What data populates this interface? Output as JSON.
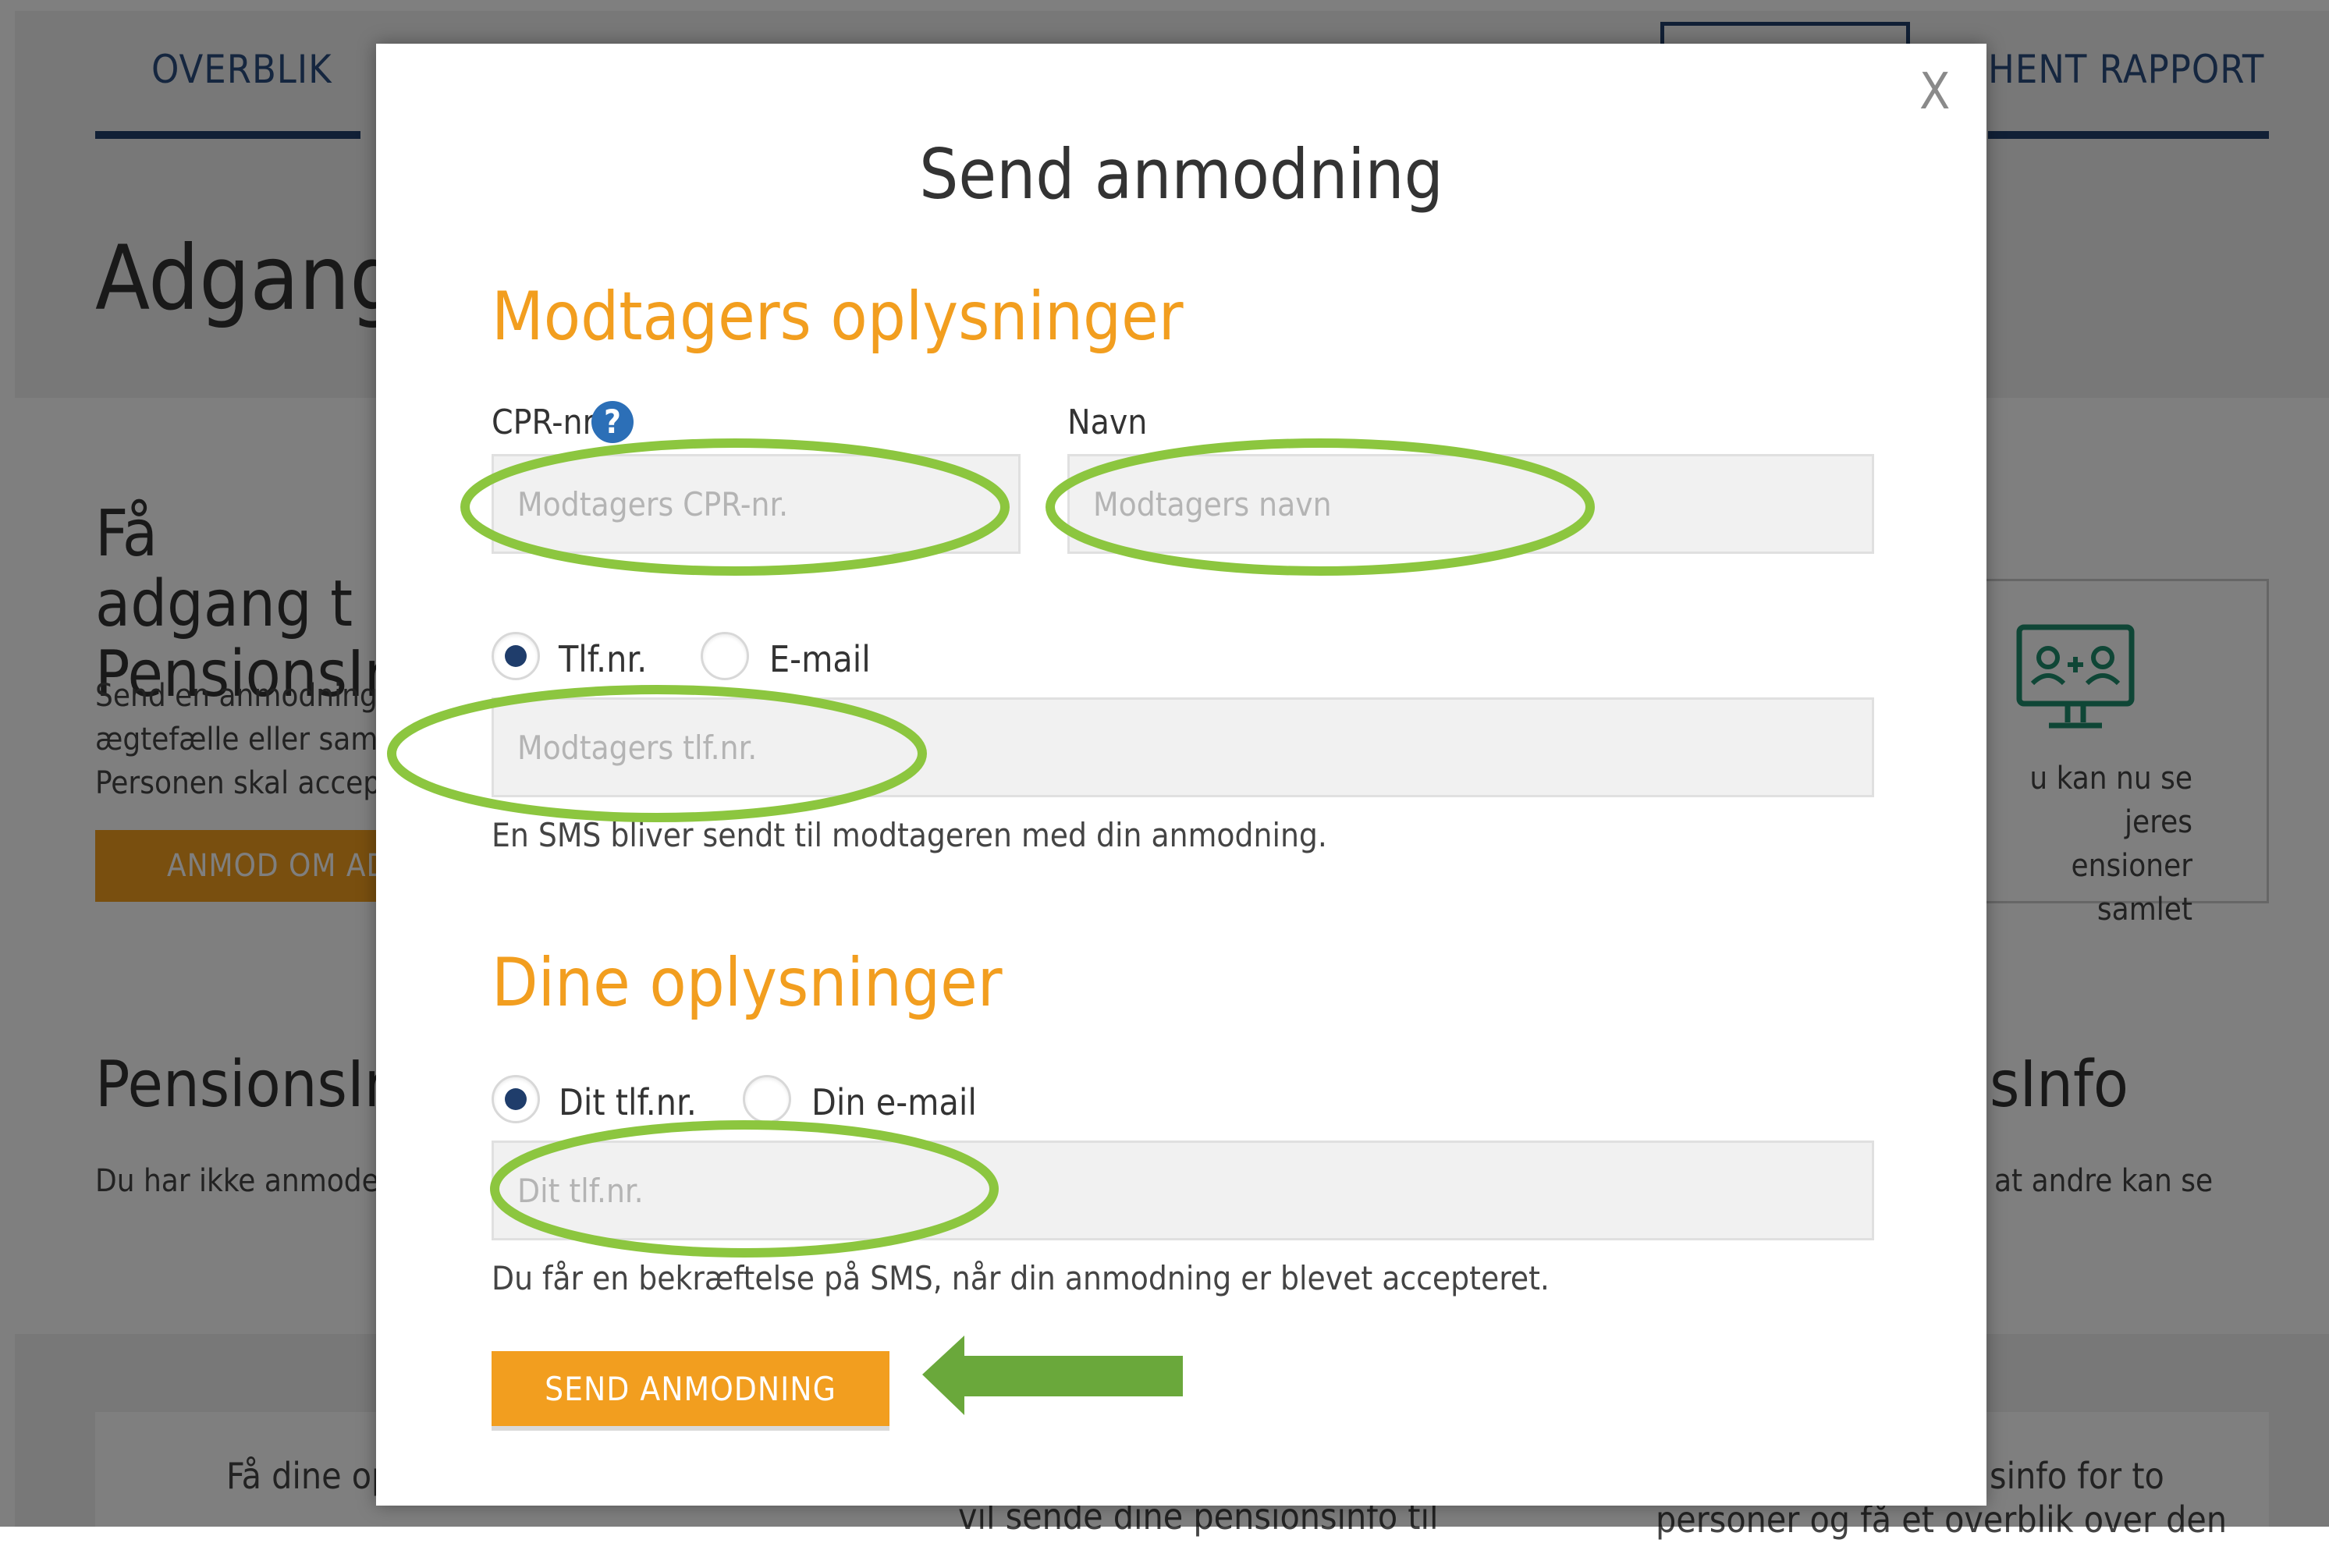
{
  "background": {
    "tabs": [
      "OVERBLIK",
      "HENT RAPPORT"
    ],
    "heading": "Adgange",
    "section1": {
      "title": "Få adgang t PensionsInf",
      "text_lines": [
        "Send en anmodning t",
        "ægtefælle eller saml",
        "Personen skal accept"
      ],
      "button": "ANMOD OM ADG"
    },
    "feature_text_lines": [
      "u kan nu se jeres",
      "ensioner samlet"
    ],
    "section2": {
      "title": "PensionsInf",
      "text": "Du har ikke anmodet"
    },
    "section2_right": {
      "title": "sInfo",
      "text": "at andre kan se"
    },
    "bottom": {
      "left": "Få dine op",
      "center": "vil sende dine pensionsinfo til",
      "right_lines": [
        "sinfo for to",
        "personer og få et overblik over den"
      ]
    }
  },
  "modal": {
    "close": "X",
    "title": "Send anmodning",
    "recipient": {
      "heading": "Modtagers oplysninger",
      "cpr_label": "CPR-nr.",
      "help_icon": "?",
      "cpr_placeholder": "Modtagers CPR-nr.",
      "name_label": "Navn",
      "name_placeholder": "Modtagers navn",
      "contact_options": [
        {
          "label": "Tlf.nr.",
          "selected": true
        },
        {
          "label": "E-mail",
          "selected": false
        }
      ],
      "phone_placeholder": "Modtagers tlf.nr.",
      "hint": "En SMS bliver sendt til modtageren med din anmodning."
    },
    "sender": {
      "heading": "Dine oplysninger",
      "contact_options": [
        {
          "label": "Dit tlf.nr.",
          "selected": true
        },
        {
          "label": "Din e-mail",
          "selected": false
        }
      ],
      "phone_placeholder": "Dit tlf.nr.",
      "hint": "Du får en bekræftelse på SMS, når din anmodning er blevet accepteret."
    },
    "submit": "SEND ANMODNING"
  },
  "colors": {
    "accent": "#f29e1f",
    "navy": "#1f3d6b",
    "annotation_green": "#8cc63f",
    "arrow_green": "#6aa83b"
  }
}
